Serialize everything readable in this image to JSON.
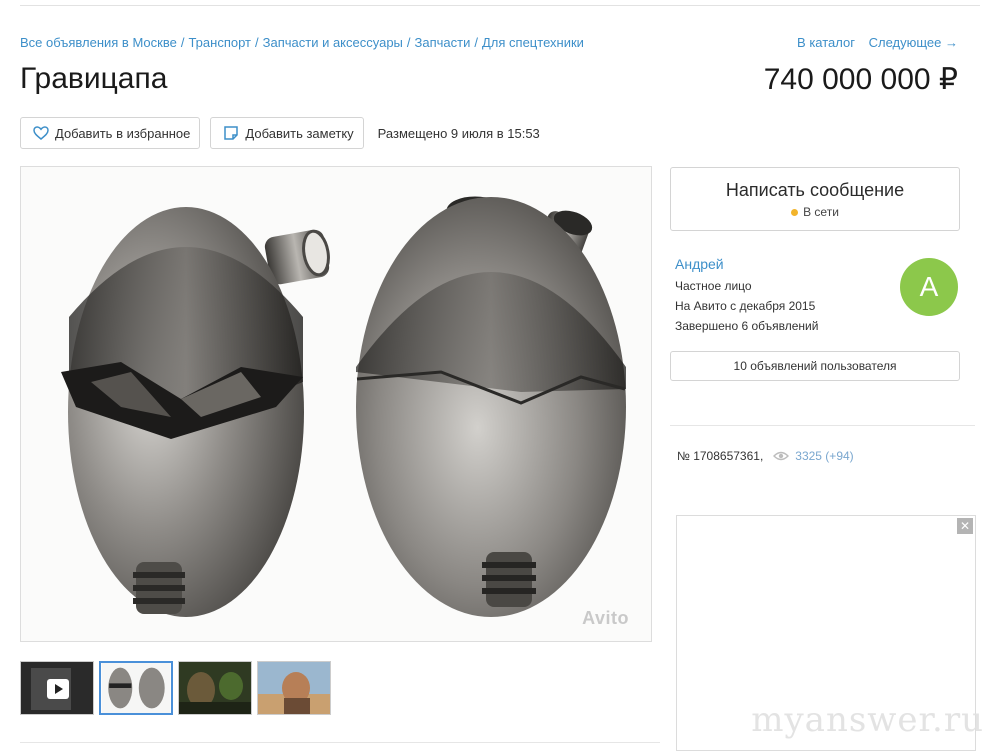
{
  "breadcrumb": {
    "items": [
      "Все объявления в Москве",
      "Транспорт",
      "Запчасти и аксессуары",
      "Запчасти",
      "Для спецтехники"
    ],
    "separator": "/"
  },
  "catalog_nav": {
    "catalog": "В каталог",
    "next": "Следующее →"
  },
  "listing": {
    "title": "Гравицапа",
    "price": "740 000 000 ₽",
    "favorite_label": "Добавить в избранное",
    "note_label": "Добавить заметку",
    "posted": "Размещено 9 июля в 15:53",
    "photo_watermark": "Avito"
  },
  "thumbnails": [
    {
      "name": "thumb-video",
      "video": true
    },
    {
      "name": "thumb-gravitsapa",
      "active": true
    },
    {
      "name": "thumb-scene-1"
    },
    {
      "name": "thumb-scene-2"
    }
  ],
  "contact": {
    "message_button": "Написать сообщение",
    "status": "В сети"
  },
  "seller": {
    "name": "Андрей",
    "type": "Частное лицо",
    "since": "На Авито с декабря 2015",
    "completed": "Завершено 6 объявлений",
    "avatar_letter": "A",
    "user_ads": "10 объявлений пользователя"
  },
  "stats": {
    "ad_number": "№ 1708657361,",
    "views": "3325 (+94)"
  },
  "ad": {
    "close": "✕"
  },
  "site_watermark": "myanswer.ru",
  "colors": {
    "link": "#3d8fc9",
    "avatar": "#8cc84b",
    "online": "#f2b42b"
  }
}
